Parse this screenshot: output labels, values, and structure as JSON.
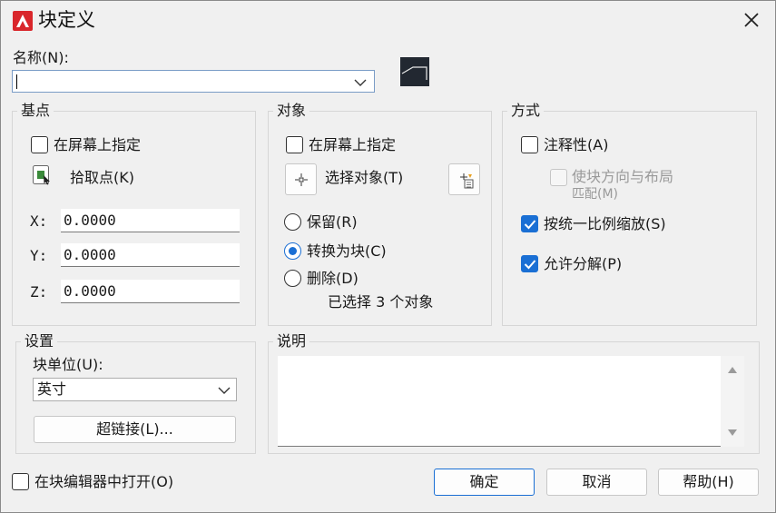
{
  "window": {
    "title": "块定义"
  },
  "name": {
    "label": "名称(N):",
    "value": ""
  },
  "base_point": {
    "title": "基点",
    "specify_on_screen": "在屏幕上指定",
    "pick_point": "拾取点(K)",
    "x_label": "X:",
    "x_value": "0.0000",
    "y_label": "Y:",
    "y_value": "0.0000",
    "z_label": "Z:",
    "z_value": "0.0000"
  },
  "objects": {
    "title": "对象",
    "specify_on_screen": "在屏幕上指定",
    "select_objects": "选择对象(T)",
    "retain": "保留(R)",
    "convert": "转换为块(C)",
    "delete": "删除(D)",
    "status": "已选择 3 个对象"
  },
  "behavior": {
    "title": "方式",
    "annotative": "注释性(A)",
    "match_orientation_1": "使块方向与布局",
    "match_orientation_2": "匹配(M)",
    "scale_uniformly": "按统一比例缩放(S)",
    "allow_explode": "允许分解(P)"
  },
  "settings": {
    "title": "设置",
    "block_unit_label": "块单位(U):",
    "block_unit_value": "英寸",
    "hyperlink": "超链接(L)..."
  },
  "description": {
    "title": "说明",
    "value": ""
  },
  "footer": {
    "open_in_editor": "在块编辑器中打开(O)",
    "ok": "确定",
    "cancel": "取消",
    "help": "帮助(H)"
  },
  "colors": {
    "accent": "#1a6fd4",
    "app_red": "#d9262b"
  }
}
